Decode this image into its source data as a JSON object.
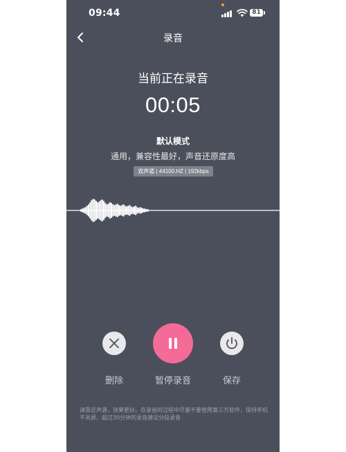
{
  "status_bar": {
    "time": "09:44",
    "battery": "81",
    "icons": [
      "signal-icon",
      "wifi-icon",
      "battery-icon"
    ]
  },
  "nav": {
    "back_icon": "chevron-left-icon",
    "title": "录音"
  },
  "recording": {
    "status": "当前正在录音",
    "timer": "00:05",
    "mode_name": "默认模式",
    "mode_desc": "通用，兼容性最好，声音还原度高",
    "specs": "双声道 | 44100.HZ | 192kbps"
  },
  "controls": {
    "delete_label": "删除",
    "pause_label": "暂停录音",
    "save_label": "保存",
    "delete_icon": "close-icon",
    "pause_icon": "pause-icon",
    "save_icon": "power-icon"
  },
  "footer_note": "请靠近声源，效果更好。在录音的过程中尽量不要使用第三方软件，保持手机不关屏，超过30分钟的录音建议分段录音",
  "colors": {
    "background": "#4b4f5b",
    "accent": "#f46b97",
    "button_light": "#e9e9ec",
    "specs_badge": "#7d818b"
  }
}
